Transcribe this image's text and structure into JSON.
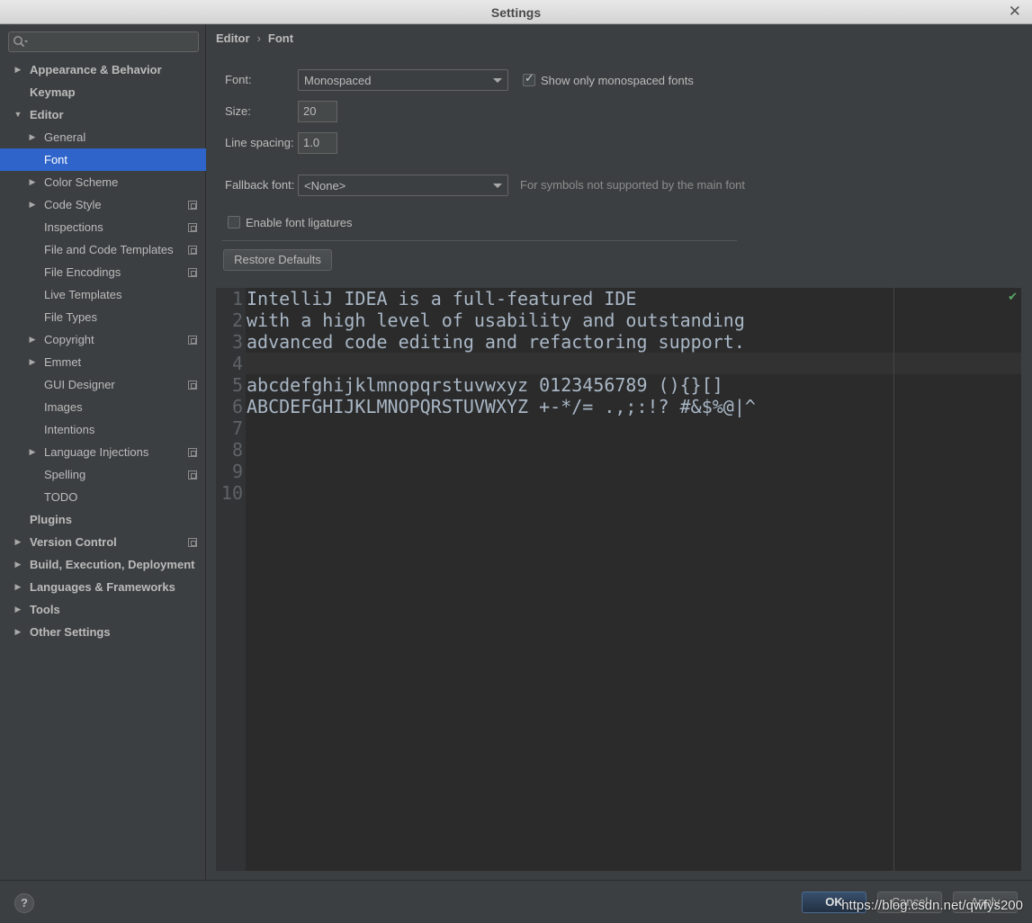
{
  "window": {
    "title": "Settings"
  },
  "search": {
    "placeholder": ""
  },
  "sidebar": {
    "items": [
      {
        "label": "Appearance & Behavior",
        "bold": true,
        "arrow": "right",
        "level": 0
      },
      {
        "label": "Keymap",
        "bold": true,
        "arrow": "",
        "level": 0
      },
      {
        "label": "Editor",
        "bold": true,
        "arrow": "down",
        "level": 0
      },
      {
        "label": "General",
        "bold": false,
        "arrow": "right",
        "level": 1
      },
      {
        "label": "Font",
        "bold": false,
        "arrow": "",
        "level": 1,
        "selected": true
      },
      {
        "label": "Color Scheme",
        "bold": false,
        "arrow": "right",
        "level": 1
      },
      {
        "label": "Code Style",
        "bold": false,
        "arrow": "right",
        "level": 1,
        "project_icon": true
      },
      {
        "label": "Inspections",
        "bold": false,
        "arrow": "",
        "level": 1,
        "project_icon": true
      },
      {
        "label": "File and Code Templates",
        "bold": false,
        "arrow": "",
        "level": 1,
        "project_icon": true
      },
      {
        "label": "File Encodings",
        "bold": false,
        "arrow": "",
        "level": 1,
        "project_icon": true
      },
      {
        "label": "Live Templates",
        "bold": false,
        "arrow": "",
        "level": 1
      },
      {
        "label": "File Types",
        "bold": false,
        "arrow": "",
        "level": 1
      },
      {
        "label": "Copyright",
        "bold": false,
        "arrow": "right",
        "level": 1,
        "project_icon": true
      },
      {
        "label": "Emmet",
        "bold": false,
        "arrow": "right",
        "level": 1
      },
      {
        "label": "GUI Designer",
        "bold": false,
        "arrow": "",
        "level": 1,
        "project_icon": true
      },
      {
        "label": "Images",
        "bold": false,
        "arrow": "",
        "level": 1
      },
      {
        "label": "Intentions",
        "bold": false,
        "arrow": "",
        "level": 1
      },
      {
        "label": "Language Injections",
        "bold": false,
        "arrow": "right",
        "level": 1,
        "project_icon": true
      },
      {
        "label": "Spelling",
        "bold": false,
        "arrow": "",
        "level": 1,
        "project_icon": true
      },
      {
        "label": "TODO",
        "bold": false,
        "arrow": "",
        "level": 1
      },
      {
        "label": "Plugins",
        "bold": true,
        "arrow": "",
        "level": 0
      },
      {
        "label": "Version Control",
        "bold": true,
        "arrow": "right",
        "level": 0,
        "project_icon": true
      },
      {
        "label": "Build, Execution, Deployment",
        "bold": true,
        "arrow": "right",
        "level": 0
      },
      {
        "label": "Languages & Frameworks",
        "bold": true,
        "arrow": "right",
        "level": 0
      },
      {
        "label": "Tools",
        "bold": true,
        "arrow": "right",
        "level": 0
      },
      {
        "label": "Other Settings",
        "bold": true,
        "arrow": "right",
        "level": 0
      }
    ]
  },
  "breadcrumb": {
    "parent": "Editor",
    "separator": "›",
    "current": "Font"
  },
  "form": {
    "font_label": "Font:",
    "font_value": "Monospaced",
    "show_mono_label": "Show only monospaced fonts",
    "show_mono_checked": true,
    "size_label": "Size:",
    "size_value": "20",
    "line_spacing_label": "Line spacing:",
    "line_spacing_value": "1.0",
    "fallback_label": "Fallback font:",
    "fallback_value": "<None>",
    "fallback_hint": "For symbols not supported by the main font",
    "ligatures_label": "Enable font ligatures",
    "ligatures_checked": false,
    "restore_label": "Restore Defaults"
  },
  "preview": {
    "line_numbers": [
      "1",
      "2",
      "3",
      "4",
      "5",
      "6",
      "7",
      "8",
      "9",
      "10"
    ],
    "lines": [
      "IntelliJ IDEA is a full-featured IDE",
      "with a high level of usability and outstanding",
      "advanced code editing and refactoring support.",
      "",
      "abcdefghijklmnopqrstuvwxyz 0123456789 (){}[]",
      "ABCDEFGHIJKLMNOPQRSTUVWXYZ +-*/= .,;:!? #&$%@|^"
    ],
    "status_icon": "check-icon"
  },
  "footer": {
    "help_label": "?",
    "ok_label": "OK",
    "cancel_label": "Cancel",
    "apply_label": "Apply",
    "watermark": "https://blog.csdn.net/qwfys200"
  },
  "colors": {
    "background": "#3c3f41",
    "selection": "#2f65ca",
    "editor_bg": "#2b2b2b",
    "code_text": "#a9b7c6"
  }
}
